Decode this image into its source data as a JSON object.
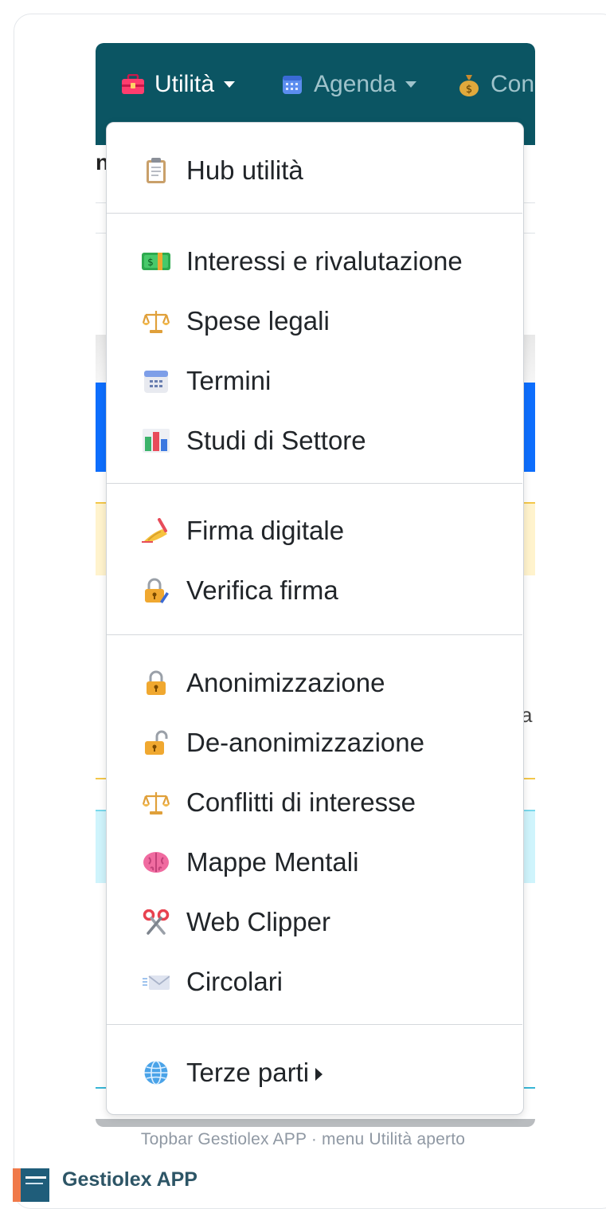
{
  "topbar": {
    "items": [
      {
        "label": "Utilità",
        "icon": "toolbox-icon"
      },
      {
        "label": "Agenda",
        "icon": "calendar-icon"
      },
      {
        "label": "Con",
        "icon": "money-bag-icon"
      }
    ],
    "background": "#0b5563"
  },
  "background_page": {
    "title_fragment": "n",
    "side_fragment": "a"
  },
  "menu": {
    "items": [
      {
        "label": "Hub utilità",
        "icon": "clipboard-icon"
      },
      {
        "label": "Interessi e rivalutazione",
        "icon": "money-icon"
      },
      {
        "label": "Spese legali",
        "icon": "scales-icon"
      },
      {
        "label": "Termini",
        "icon": "calendar-icon"
      },
      {
        "label": "Studi di Settore",
        "icon": "bar-chart-icon"
      },
      {
        "label": "Firma digitale",
        "icon": "writing-hand-icon"
      },
      {
        "label": "Verifica firma",
        "icon": "lock-pen-icon"
      },
      {
        "label": "Anonimizzazione",
        "icon": "lock-icon"
      },
      {
        "label": "De-anonimizzazione",
        "icon": "unlock-icon"
      },
      {
        "label": "Conflitti di interesse",
        "icon": "scales-icon"
      },
      {
        "label": "Mappe Mentali",
        "icon": "brain-icon"
      },
      {
        "label": "Web Clipper",
        "icon": "scissors-icon"
      },
      {
        "label": "Circolari",
        "icon": "envelope-icon"
      },
      {
        "label": "Terze parti",
        "icon": "globe-icon"
      }
    ]
  },
  "caption": "Topbar Gestiolex APP · menu Utilità aperto",
  "footer": {
    "title": "Gestiolex APP"
  }
}
